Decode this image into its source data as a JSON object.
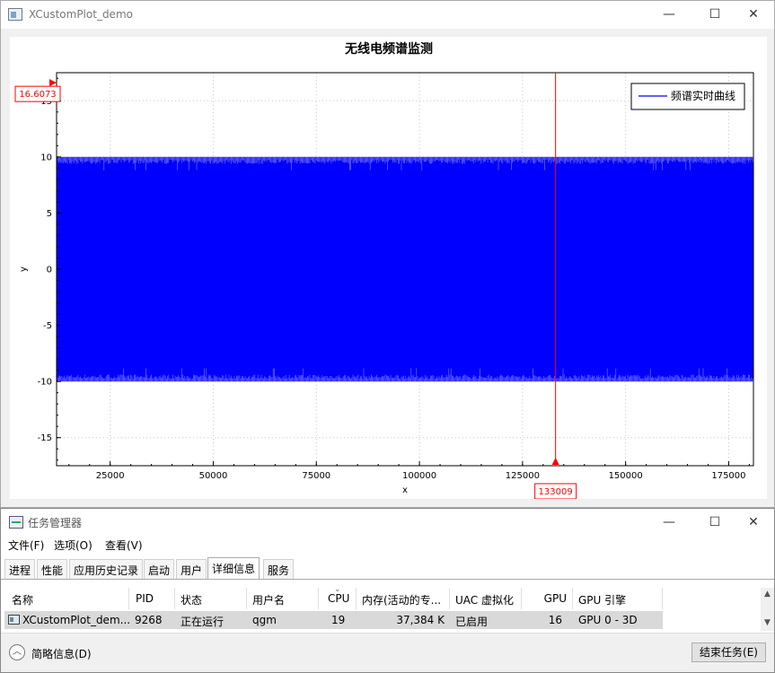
{
  "window": {
    "title": "XCustomPlot_demo",
    "minimize": "—",
    "maximize": "☐",
    "close": "✕"
  },
  "chart_data": {
    "type": "area",
    "title": "无线电频谱监测",
    "xlabel": "x",
    "ylabel": "y",
    "xlim": [
      12000,
      181000
    ],
    "ylim": [
      -17.5,
      17.5
    ],
    "xticks": [
      25000,
      50000,
      75000,
      100000,
      125000,
      150000,
      175000
    ],
    "yticks": [
      -15,
      -10,
      -5,
      0,
      5,
      10,
      15
    ],
    "grid": true,
    "legend_position": "top-right",
    "series": [
      {
        "name": "频谱实时曲线",
        "band_upper": 10,
        "band_lower": -10,
        "color": "#0000ff"
      }
    ],
    "cursor": {
      "x": 133009,
      "x_label": "133009",
      "y": 16.6073,
      "y_label": "16.6073",
      "color": "#ff0000"
    }
  },
  "taskmgr": {
    "title": "任务管理器",
    "minimize": "—",
    "maximize": "☐",
    "close": "✕",
    "menu": [
      "文件(F)",
      "选项(O)",
      "查看(V)"
    ],
    "tabs": [
      "进程",
      "性能",
      "应用历史记录",
      "启动",
      "用户",
      "详细信息",
      "服务"
    ],
    "active_tab": "详细信息",
    "columns": [
      "名称",
      "PID",
      "状态",
      "用户名",
      "CPU",
      "内存(活动的专...",
      "UAC 虚拟化",
      "GPU",
      "GPU 引擎"
    ],
    "sort_indicator": "⌄",
    "row": {
      "name": "XCustomPlot_dem...",
      "pid": "9268",
      "status": "正在运行",
      "user": "qgm",
      "cpu": "19",
      "memory": "37,384 K",
      "uac": "已启用",
      "gpu": "16",
      "gpu_engine": "GPU 0 - 3D"
    },
    "brief_label": "简略信息(D)",
    "end_task_label": "结束任务(E)"
  }
}
